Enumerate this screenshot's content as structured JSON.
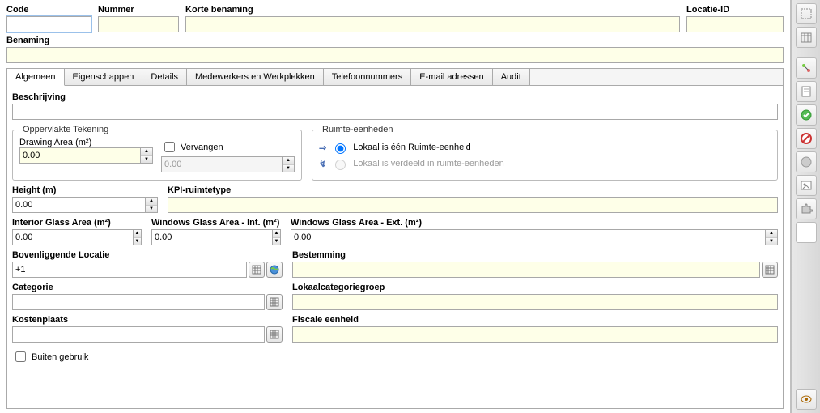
{
  "labels": {
    "code": "Code",
    "nummer": "Nummer",
    "korte_benaming": "Korte benaming",
    "locatie_id": "Locatie-ID",
    "benaming": "Benaming",
    "beschrijving": "Beschrijving",
    "oppervlakte_tekening": "Oppervlakte Tekening",
    "drawing_area": "Drawing Area (m²)",
    "vervangen": "Vervangen",
    "ruimte_eenheden": "Ruimte-eenheden",
    "radio1": "Lokaal is één Ruimte-eenheid",
    "radio2": "Lokaal is verdeeld in ruimte-eenheden",
    "height": "Height (m)",
    "kpi": "KPI-ruimtetype",
    "int_glass": "Interior Glass Area (m²)",
    "win_glass_int": "Windows Glass Area - Int. (m²)",
    "win_glass_ext": "Windows Glass Area - Ext. (m²)",
    "bovenliggende": "Bovenliggende Locatie",
    "bestemming": "Bestemming",
    "categorie": "Categorie",
    "lokaalcategoriegroep": "Lokaalcategoriegroep",
    "kostenplaats": "Kostenplaats",
    "fiscale": "Fiscale eenheid",
    "buiten_gebruik": "Buiten gebruik"
  },
  "values": {
    "code": "",
    "nummer": "",
    "korte_benaming": "",
    "locatie_id": "",
    "benaming": "",
    "beschrijving": "",
    "drawing_area": "0.00",
    "vervangen_val": "0.00",
    "height": "0.00",
    "kpi": "",
    "int_glass": "0.00",
    "win_glass_int": "0.00",
    "win_glass_ext": "0.00",
    "bovenliggende": "+1",
    "bestemming": "",
    "categorie": "",
    "lokaalcategoriegroep": "",
    "kostenplaats": "",
    "fiscale": ""
  },
  "tabs": [
    "Algemeen",
    "Eigenschappen",
    "Details",
    "Medewerkers en Werkplekken",
    "Telefoonnummers",
    "E-mail adressen",
    "Audit"
  ]
}
